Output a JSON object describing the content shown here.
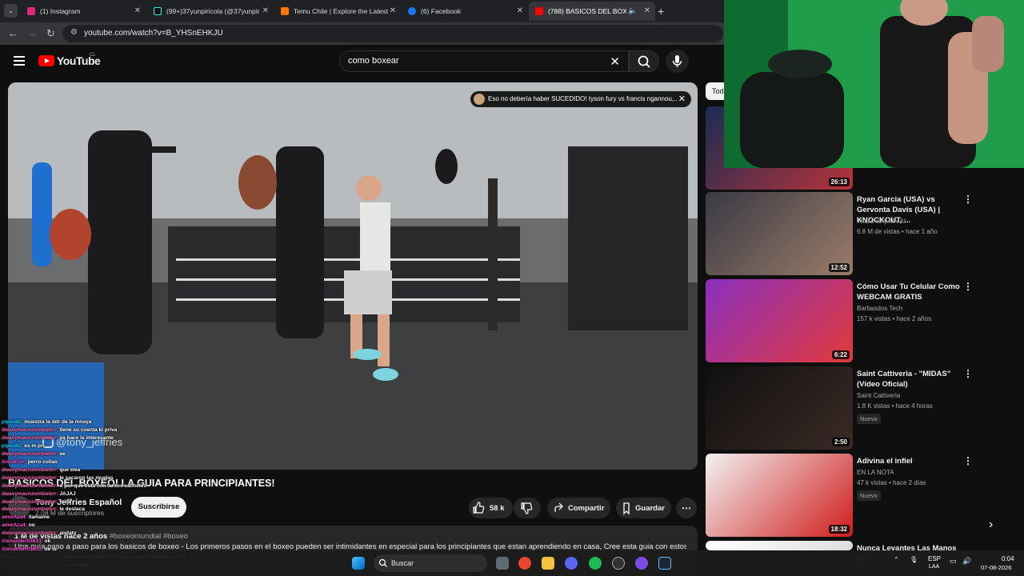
{
  "browser": {
    "tabs": [
      {
        "title": "(1) Instagram",
        "color": "#dd2a7b"
      },
      {
        "title": "(99+)37yunpiricola (@37yunpir",
        "color": "#000000"
      },
      {
        "title": "Temu Chile | Explore the Latest",
        "color": "#fb7701"
      },
      {
        "title": "(6) Facebook",
        "color": "#1877f2"
      },
      {
        "title": "(788) BASICOS DEL BOXEO!",
        "color": "#ff0000"
      }
    ],
    "url": "youtube.com/watch?v=B_YHSnEHKJU"
  },
  "youtube": {
    "logo": "YouTube",
    "country": "CL",
    "search_query": "como boxear"
  },
  "notification": "Eso no debería haber SUCEDIDO! tyson fury vs francis ngannou,...",
  "watermark": "@tony_jeffries",
  "video": {
    "title": "BASICOS DEL BOXEO! LA GUIA PARA PRINCIPIANTES!",
    "channel": "Tony Jeffries Español",
    "subscribers": "2.08 M de suscriptores",
    "subscribe_label": "Suscribirse",
    "likes": "58 k",
    "share_label": "Compartir",
    "save_label": "Guardar",
    "views": "1 M de vistas  hace 2 años",
    "tags": "#boxeomundial #boxeo",
    "description": "Una guía paso a paso para los basicos de boxeo - Los primeros pasos en el boxeo pueden ser intimidantes en especial para los principiantes que estan aprendiendo en casa, Cree esta guia con estos"
  },
  "chat": [
    {
      "user": "pipea82:",
      "msg": "muestra la ddr de la mnaya",
      "color": "#00d5ff"
    },
    {
      "user": "dwavymacnzombiebrr:",
      "msg": "tiene su cuenta ki priva",
      "color": "#ff69b4"
    },
    {
      "user": "dwavymacnzombiebrr:",
      "msg": "ya hace la interesante",
      "color": "#ff69b4"
    },
    {
      "user": "pipea82:",
      "msg": "es m pri",
      "color": "#00d5ff"
    },
    {
      "user": "dwavymacnzombiebrr:",
      "msg": "ee",
      "color": "#ff69b4"
    },
    {
      "user": "AnnaFlor:",
      "msg": "perro culiao",
      "color": "#ff4bd2"
    },
    {
      "user": "dwavymacnzombiebrr:",
      "msg": "que wea",
      "color": "#ff69b4"
    },
    {
      "user": "dwavymacnzombiebrr:",
      "msg": "le sacaron las muelas",
      "color": "#ff69b4"
    },
    {
      "user": "dwavymacnzombiebrr:",
      "msg": "o por qué está con tantos cachetes",
      "color": "#ff69b4"
    },
    {
      "user": "dwavymacnzombiebrr:",
      "msg": "JAJAJ",
      "color": "#ff69b4"
    },
    {
      "user": "dwavymacnzombiebrr:",
      "msg": "mira",
      "color": "#ff69b4"
    },
    {
      "user": "dwavymacnzombiebrr:",
      "msg": "le destaca",
      "color": "#ff69b4"
    },
    {
      "user": "amwAza4:",
      "msg": "llamame",
      "color": "#ff4bd2"
    },
    {
      "user": "amwAza4:",
      "msg": "no",
      "color": "#ff4bd2"
    },
    {
      "user": "dwavymacnzombiebrr:",
      "msg": "andaty",
      "color": "#ff69b4"
    },
    {
      "user": "Alexander03633:",
      "msg": "ok",
      "color": "#ff4bd2"
    },
    {
      "user": "Alexander03633:",
      "msg": "de ig",
      "color": "#ff4bd2"
    },
    {
      "user": "dwavymacnzombiebrr:",
      "msg": "sangreeee cuidado que tu pieza se desarma sangre",
      "color": "#ff69b4"
    },
    {
      "user": "dwavymacnzombiebrr:",
      "msg": "digo nomas",
      "color": "#ff69b4"
    }
  ],
  "sidebar": {
    "chip": "Todos",
    "recs": [
      {
        "title": "",
        "channel": "",
        "views": "",
        "duration": "26:13",
        "badge": "",
        "colors": [
          "#1b2c52",
          "#b6333a"
        ]
      },
      {
        "title": "Ryan Garcia (USA) vs Gervonta Davis (USA) | KNOCKOUT, ...",
        "channel": "That's why MMA!",
        "views": "6.8 M de vistas • hace 1 año",
        "duration": "12:52",
        "badge": "",
        "colors": [
          "#3a3a45",
          "#9a7c68"
        ]
      },
      {
        "title": "Cómo Usar Tu Celular Como WEBCAM GRATIS",
        "channel": "Barbasdos Tech",
        "views": "157 k vistas • hace 2 años",
        "duration": "6:22",
        "badge": "",
        "colors": [
          "#8b2fbf",
          "#e13a3a"
        ]
      },
      {
        "title": "Saint Cattiveria - \"MIDAS\" (Video Oficial)",
        "channel": "Saint Cattiveria",
        "views": "1.8 K vistas • hace 4 horas",
        "duration": "2:50",
        "badge": "Nuevo",
        "colors": [
          "#101010",
          "#3a2a25"
        ]
      },
      {
        "title": "Adivina el infiel",
        "channel": "EN LA NOTA",
        "views": "47 k vistas • hace 2 días",
        "duration": "18:32",
        "badge": "Nuevo",
        "colors": [
          "#f2f2f2",
          "#d01c1c"
        ]
      },
      {
        "title": "Nunca Levantes Las Manos En",
        "channel": "",
        "views": "",
        "duration": "",
        "badge": "",
        "colors": [
          "#ffffff",
          "#dddddd"
        ]
      }
    ]
  },
  "taskbar": {
    "search": "Buscar",
    "lang": "ESP",
    "lang2": "LAA",
    "time": "0:04",
    "date": "07-08-2026"
  }
}
